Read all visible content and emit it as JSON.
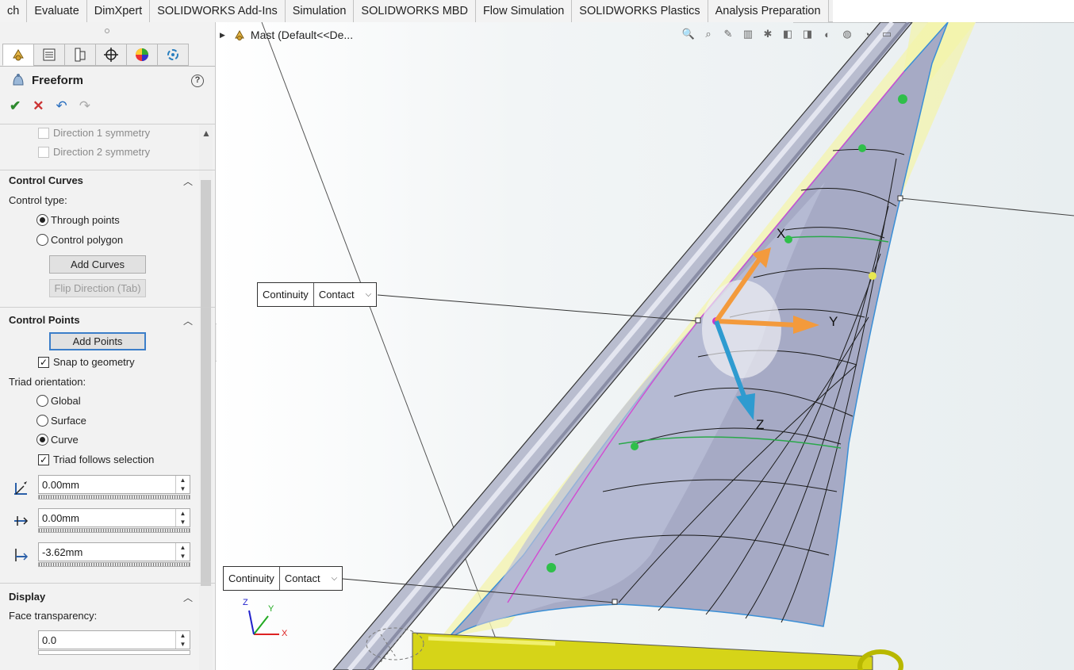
{
  "tabs": [
    "ch",
    "Evaluate",
    "DimXpert",
    "SOLIDWORKS Add-Ins",
    "Simulation",
    "SOLIDWORKS MBD",
    "Flow Simulation",
    "SOLIDWORKS Plastics",
    "Analysis Preparation"
  ],
  "panel": {
    "title": "Freeform",
    "help_glyph": "?",
    "actions": {
      "ok": "✔",
      "cancel": "✕",
      "undo": "↶",
      "redo": "↷"
    },
    "symmetry": [
      "Direction 1 symmetry",
      "Direction 2 symmetry"
    ],
    "control_curves": {
      "title": "Control Curves",
      "control_type_label": "Control type:",
      "options": [
        "Through points",
        "Control polygon"
      ],
      "selected": "Through points",
      "add_curves": "Add Curves",
      "flip_direction": "Flip Direction (Tab)"
    },
    "control_points": {
      "title": "Control Points",
      "add_points": "Add Points",
      "snap_to_geometry": "Snap to geometry",
      "snap_checked": true,
      "triad_label": "Triad orientation:",
      "triad_options": [
        "Global",
        "Surface",
        "Curve"
      ],
      "triad_selected": "Curve",
      "triad_follows": "Triad follows selection",
      "triad_follows_checked": true,
      "values": [
        "0.00mm",
        "0.00mm",
        "-3.62mm"
      ]
    },
    "display": {
      "title": "Display",
      "face_transparency_label": "Face transparency:",
      "face_transparency": "0.0"
    }
  },
  "viewport": {
    "tree_item": "Mast  (Default<<De...",
    "callouts": [
      {
        "label": "Continuity",
        "value": "Contact"
      },
      {
        "label": "Continuity",
        "value": "Contact"
      }
    ],
    "triad_labels": {
      "x": "X",
      "y": "Y",
      "z": "Z"
    },
    "orientation_axes": {
      "x": "X",
      "y": "Y",
      "z": "Z"
    }
  },
  "colors": {
    "surface": "#a9adc8",
    "tube": "#b8bccc",
    "triad_orange": "#f39a3c",
    "triad_blue": "#2e9bd0",
    "curve_green": "#2aa84a",
    "edge_blue": "#3a8fd6",
    "yellow_plane": "#f4f4b0"
  }
}
